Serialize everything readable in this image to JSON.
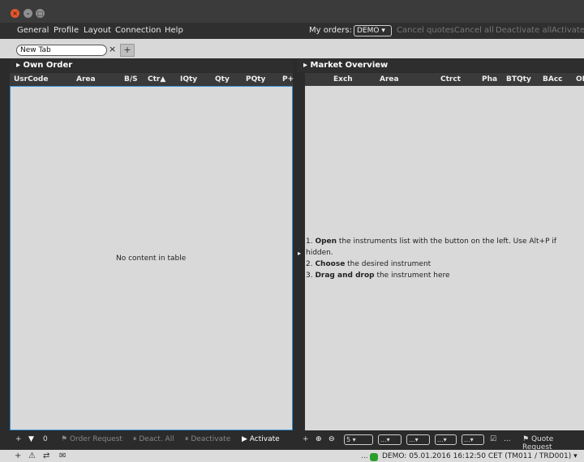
{
  "menu": {
    "items": [
      "General",
      "Profile",
      "Layout",
      "Connection",
      "Help"
    ],
    "my_orders_label": "My orders:",
    "demo_select": "DEMO",
    "cancel_quotes": "Cancel quotes",
    "cancel_all": "Cancel all",
    "deactivate_all": "Deactivate all",
    "activate": "Activate"
  },
  "tabs": {
    "current": "New Tab",
    "close": "×",
    "add": "+"
  },
  "own_order": {
    "title": "Own Order",
    "columns": [
      "UsrCode",
      "Area",
      "B/S",
      "Ctr▲",
      "IQty",
      "Qty",
      "PQty",
      "P+"
    ],
    "empty": "No content in table",
    "toolbar": {
      "add": "+",
      "filter_count": "0",
      "order_request": "Order Request",
      "deact_all": "Deact. All",
      "deactivate": "Deactivate",
      "activate": "Activate"
    }
  },
  "market_overview": {
    "title": "Market Overview",
    "columns": [
      "Exch",
      "Area",
      "Ctrct",
      "Pha",
      "BTQty",
      "BAcc",
      "OI"
    ],
    "hint": {
      "line1_bold": "Open",
      "line1_rest": " the instruments list with the   button on the left. Use Alt+P if",
      "line1_cont": "hidden.",
      "line2_num": "2. ",
      "line2_bold": "Choose",
      "line2_rest": " the desired instrument",
      "line3_num": "3. ",
      "line3_bold": "Drag and drop",
      "line3_rest": " the instrument here"
    },
    "toolbar": {
      "add": "+",
      "depth_value": "5",
      "dropdowns": [
        "...",
        "...",
        "...",
        "..."
      ],
      "ellipsis": "...",
      "quote_request": "Quote Request"
    }
  },
  "statusbar": {
    "dots": "...",
    "text": "DEMO: 05.01.2016 16:12:50 CET (TM011 / TRD001)"
  }
}
